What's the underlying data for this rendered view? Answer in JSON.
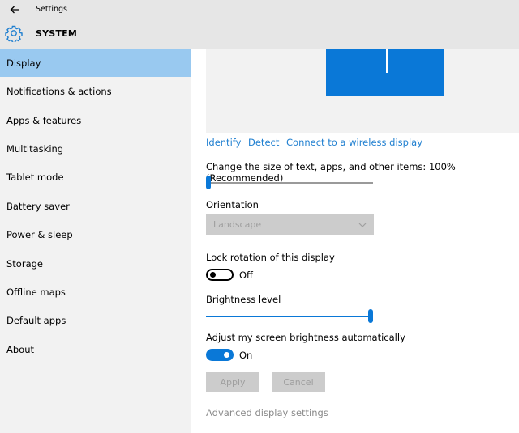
{
  "window": {
    "title": "Settings"
  },
  "header": {
    "title": "SYSTEM"
  },
  "sidebar": {
    "items": [
      {
        "label": "Display",
        "selected": true
      },
      {
        "label": "Notifications & actions"
      },
      {
        "label": "Apps & features"
      },
      {
        "label": "Multitasking"
      },
      {
        "label": "Tablet mode"
      },
      {
        "label": "Battery saver"
      },
      {
        "label": "Power & sleep"
      },
      {
        "label": "Storage"
      },
      {
        "label": "Offline maps"
      },
      {
        "label": "Default apps"
      },
      {
        "label": "About"
      }
    ]
  },
  "main": {
    "links": {
      "identify": "Identify",
      "detect": "Detect",
      "wireless": "Connect to a wireless display"
    },
    "scale": {
      "label": "Change the size of text, apps, and other items: 100% (Recommended)",
      "level": 0
    },
    "orientation": {
      "label": "Orientation",
      "value": "Landscape",
      "disabled": true
    },
    "lock_rotation": {
      "label": "Lock rotation of this display",
      "state": "Off"
    },
    "brightness": {
      "label": "Brightness level",
      "level": 1.0
    },
    "auto_brightness": {
      "label": "Adjust my screen brightness automatically",
      "state": "On"
    },
    "buttons": {
      "apply": "Apply",
      "cancel": "Cancel"
    },
    "advanced_link": "Advanced display settings"
  },
  "colors": {
    "accent": "#0a78d7",
    "selected_nav": "#99c9f0",
    "link": "#1f7fd0",
    "chrome": "#e6e6e6",
    "sidebar_bg": "#f2f2f2"
  }
}
